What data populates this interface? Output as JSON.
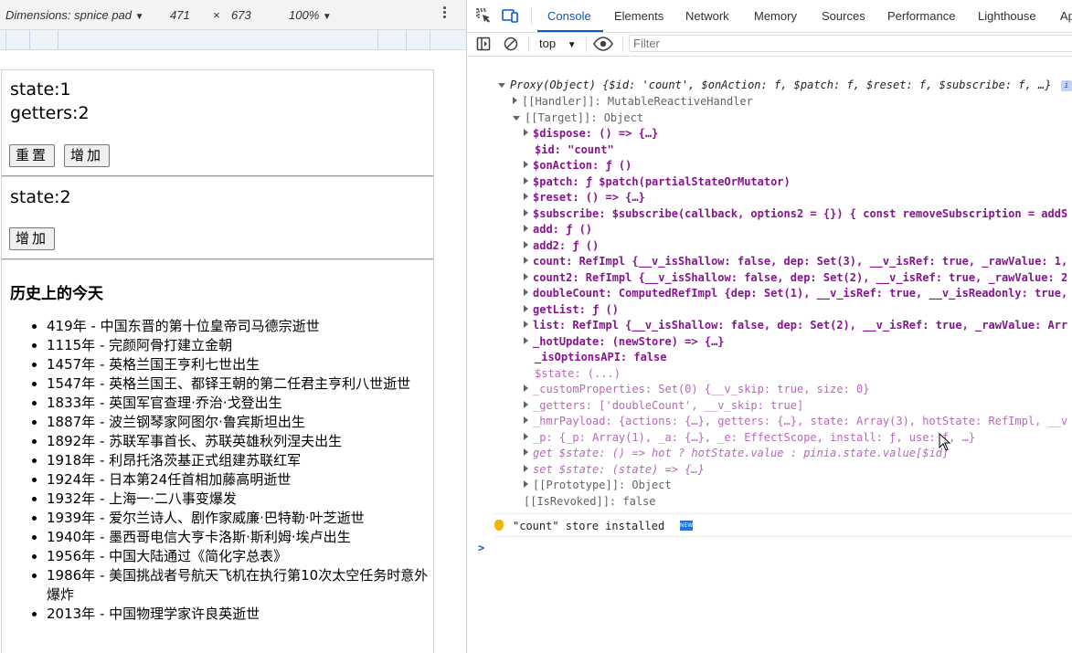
{
  "device_toolbar": {
    "dimensions_label": "Dimensions: spnice pad",
    "width": "471",
    "times": "×",
    "height": "673",
    "zoom": "100%"
  },
  "app": {
    "state1": "state:1",
    "getters": "getters:2",
    "reset_btn": "重置",
    "add_btn": "增加",
    "state2": "state:2",
    "add_btn2": "增加",
    "history_title": "历史上的今天",
    "history": [
      "419年 - 中国东晋的第十位皇帝司马德宗逝世",
      "1115年 - 完颜阿骨打建立金朝",
      "1457年 - 英格兰国王亨利七世出生",
      "1547年 - 英格兰国王、都铎王朝的第二任君主亨利八世逝世",
      "1833年 - 英国军官查理·乔治·戈登出生",
      "1887年 - 波兰钢琴家阿图尔·鲁宾斯坦出生",
      "1892年 - 苏联军事首长、苏联英雄秋列涅夫出生",
      "1918年 - 利昂托洛茨基正式组建苏联红军",
      "1924年 - 日本第24任首相加藤高明逝世",
      "1932年 - 上海一·二八事变爆发",
      "1939年 - 爱尔兰诗人、剧作家威廉·巴特勒·叶芝逝世",
      "1940年 - 墨西哥电信大亨卡洛斯·斯利姆·埃卢出生",
      "1956年 - 中国大陆通过《简化字总表》",
      "1986年 - 美国挑战者号航天飞机在执行第10次太空任务时意外爆炸",
      "2013年 - 中国物理学家许良英逝世"
    ]
  },
  "devtools": {
    "tabs": [
      "Console",
      "Elements",
      "Network",
      "Memory",
      "Sources",
      "Performance",
      "Lighthouse",
      "Ap"
    ],
    "context": "top",
    "filter_placeholder": "Filter",
    "console": {
      "proxy_header": "Proxy(Object) {$id: 'count', $onAction: f, $patch: f, $reset: f, $subscribe: f, …}",
      "info_badge": "i",
      "lines": [
        "[[Handler]]: MutableReactiveHandler",
        "[[Target]]: Object",
        "$dispose: () => {…}",
        "$id: \"count\"",
        "$onAction: ƒ ()",
        "$patch: ƒ $patch(partialStateOrMutator)",
        "$reset: () => {…}",
        "$subscribe: $subscribe(callback, options2 = {}) { const removeSubscription = addS",
        "add: ƒ ()",
        "add2: ƒ ()",
        "count: RefImpl {__v_isShallow: false, dep: Set(3), __v_isRef: true, _rawValue: 1,",
        "count2: RefImpl {__v_isShallow: false, dep: Set(2), __v_isRef: true, _rawValue: 2",
        "doubleCount: ComputedRefImpl {dep: Set(1), __v_isRef: true, __v_isReadonly: true,",
        "getList: ƒ ()",
        "list: RefImpl {__v_isShallow: false, dep: Set(2), __v_isRef: true, _rawValue: Arr",
        "_hotUpdate: (newStore) => {…}",
        "_isOptionsAPI: false",
        "$state: (...)",
        "_customProperties: Set(0) {__v_skip: true, size: 0}",
        "_getters: ['doubleCount', __v_skip: true]",
        "_hmrPayload: {actions: {…}, getters: {…}, state: Array(3), hotState: RefImpl, __v",
        "_p: {_p: Array(1), _a: {…}, _e: EffectScope, install: ƒ, use: ƒ, …}",
        "get $state: () => hot ? hotState.value : pinia.state.value[$id]",
        "set $state: (state) => {…}",
        "[[Prototype]]: Object",
        "[[IsRevoked]]: false"
      ],
      "store_message": "\"count\" store installed",
      "new_badge": "NEW",
      "prompt": ">"
    }
  }
}
